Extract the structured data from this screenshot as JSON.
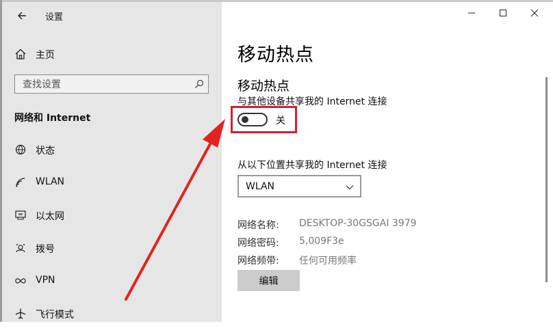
{
  "app": {
    "title": "设置",
    "back_label": "back"
  },
  "sidebar": {
    "home": "主页",
    "search_placeholder": "查找设置",
    "section": "网络和 Internet",
    "items": [
      {
        "label": "状态",
        "icon": "home-status-icon"
      },
      {
        "label": "WLAN",
        "icon": "wifi-icon"
      },
      {
        "label": "以太网",
        "icon": "ethernet-icon"
      },
      {
        "label": "拨号",
        "icon": "dialup-icon"
      },
      {
        "label": "VPN",
        "icon": "vpn-icon"
      },
      {
        "label": "飞行模式",
        "icon": "airplane-icon"
      }
    ]
  },
  "main": {
    "page_title": "移动热点",
    "hotspot": {
      "title": "移动热点",
      "description": "与其他设备共享我的 Internet 连接",
      "toggle_state": "关",
      "toggle_on": false
    },
    "share_from": {
      "label": "从以下位置共享我的 Internet 连接",
      "selected": "WLAN"
    },
    "info": [
      {
        "key": "网络名称:",
        "value": "DESKTOP-30GSGAI 3979"
      },
      {
        "key": "网络密码:",
        "value": "5,009F3e"
      },
      {
        "key": "网络频带:",
        "value": "任何可用频率"
      }
    ],
    "edit_button": "编辑"
  },
  "colors": {
    "highlight": "#d1202d",
    "sidebar_bg": "#e6e6e6"
  }
}
